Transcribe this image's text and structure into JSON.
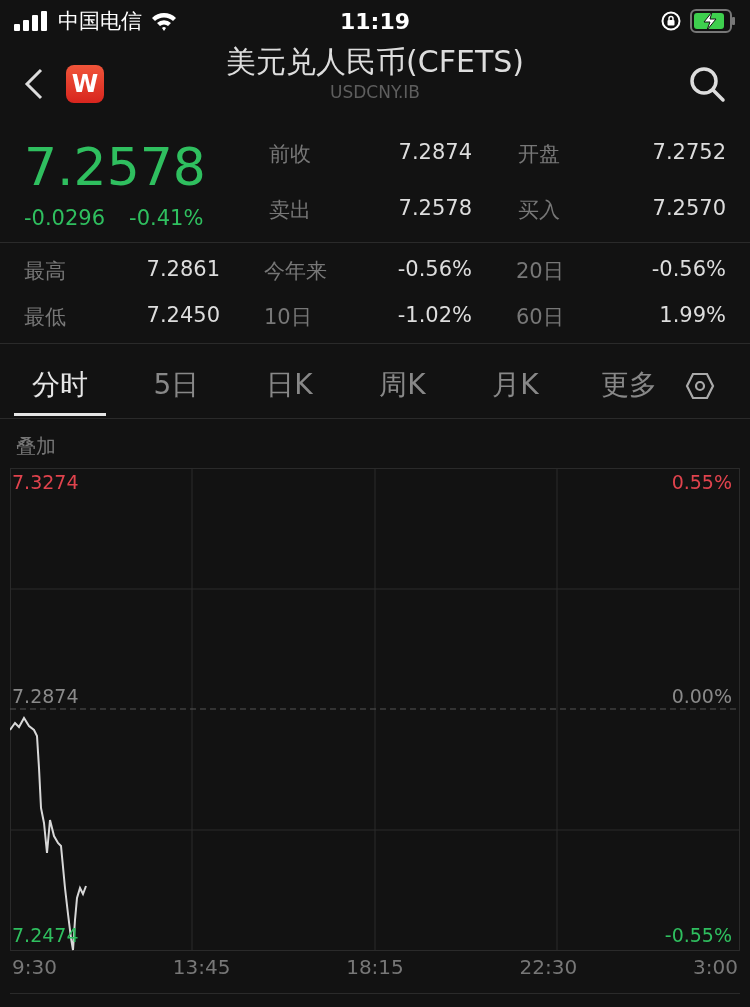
{
  "status_bar": {
    "carrier": "中国电信",
    "time": "11:19"
  },
  "header": {
    "title": "美元兑人民币(CFETS)",
    "subtitle": "USDCNY.IB",
    "badge": "W"
  },
  "quote": {
    "price": "7.2578",
    "change": "-0.0296",
    "change_pct": "-0.41%",
    "down": true,
    "fields": [
      {
        "label": "前收",
        "value": "7.2874"
      },
      {
        "label": "开盘",
        "value": "7.2752"
      },
      {
        "label": "卖出",
        "value": "7.2578"
      },
      {
        "label": "买入",
        "value": "7.2570"
      }
    ]
  },
  "stats": [
    {
      "label": "最高",
      "value": "7.2861"
    },
    {
      "label": "今年来",
      "value": "-0.56%"
    },
    {
      "label": "20日",
      "value": "-0.56%"
    },
    {
      "label": "最低",
      "value": "7.2450"
    },
    {
      "label": "10日",
      "value": "-1.02%"
    },
    {
      "label": "60日",
      "value": "1.99%"
    }
  ],
  "tabs": [
    {
      "label": "分时",
      "selected": true
    },
    {
      "label": "5日",
      "selected": false
    },
    {
      "label": "日K",
      "selected": false
    },
    {
      "label": "周K",
      "selected": false
    },
    {
      "label": "月K",
      "selected": false
    },
    {
      "label": "更多",
      "selected": false
    }
  ],
  "chart": {
    "overlay_label": "叠加",
    "levels": [
      {
        "price": "7.3274",
        "pct": "0.55%",
        "kind": "up"
      },
      {
        "price": "7.2874",
        "pct": "0.00%",
        "kind": "flat"
      },
      {
        "price": "7.2474",
        "pct": "-0.55%",
        "kind": "down"
      }
    ],
    "times": [
      "9:30",
      "13:45",
      "18:15",
      "22:30",
      "3:00"
    ]
  }
}
